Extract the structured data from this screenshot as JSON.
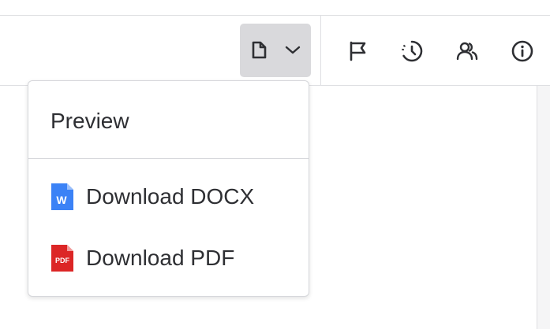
{
  "toolbar": {
    "document_button": {
      "icons": [
        "file-icon",
        "chevron-down-icon"
      ],
      "background": "#d9d9dc"
    },
    "right_icons": [
      "flag-icon",
      "history-icon",
      "users-icon",
      "info-icon"
    ]
  },
  "dropdown": {
    "items": [
      {
        "label": "Preview"
      },
      {
        "label": "Download DOCX",
        "icon": "word-file-icon",
        "icon_text": "W",
        "icon_color": "#3b82f6"
      },
      {
        "label": "Download PDF",
        "icon": "pdf-file-icon",
        "icon_text": "PDF",
        "icon_color": "#dc2626"
      }
    ]
  }
}
